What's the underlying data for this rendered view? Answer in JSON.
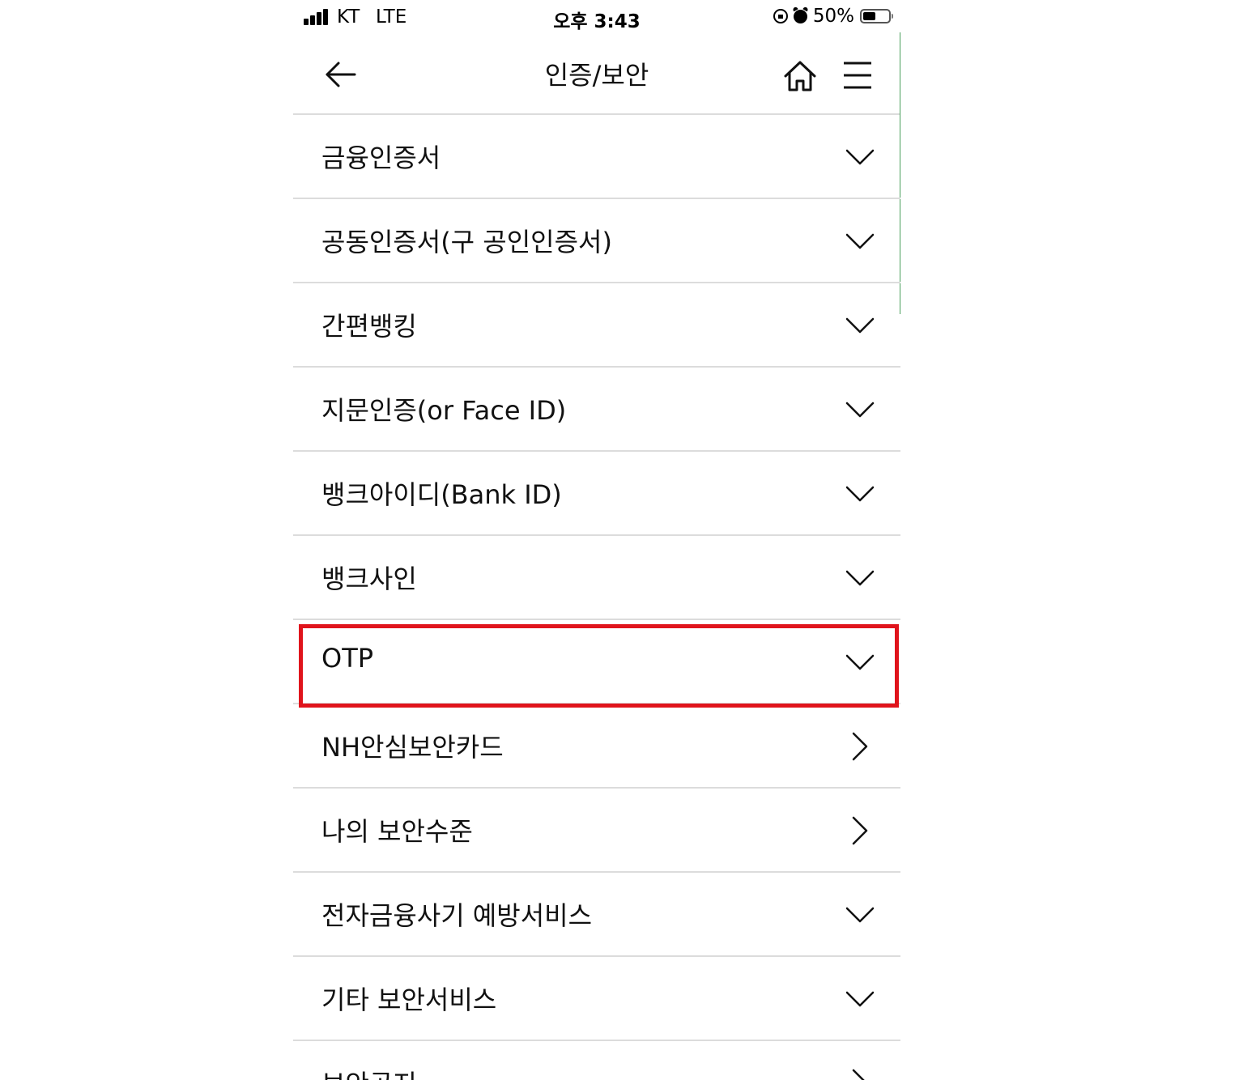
{
  "status_bar": {
    "carrier": "KT",
    "network": "LTE",
    "time": "오후 3:43",
    "battery": "50%",
    "battery_level": 0.5
  },
  "header": {
    "title": "인증/보안",
    "back_icon": "arrow-left-icon",
    "home_icon": "home-icon",
    "menu_icon": "hamburger-menu-icon"
  },
  "menu": {
    "items": [
      {
        "label": "금융인증서",
        "icon": "chevron-down-icon"
      },
      {
        "label": "공동인증서(구 공인인증서)",
        "icon": "chevron-down-icon"
      },
      {
        "label": "간편뱅킹",
        "icon": "chevron-down-icon"
      },
      {
        "label": "지문인증(or Face ID)",
        "icon": "chevron-down-icon"
      },
      {
        "label": "뱅크아이디(Bank ID)",
        "icon": "chevron-down-icon"
      },
      {
        "label": "뱅크사인",
        "icon": "chevron-down-icon"
      },
      {
        "label": "OTP",
        "icon": "chevron-down-icon",
        "highlighted": true
      },
      {
        "label": "NH안심보안카드",
        "icon": "chevron-right-icon"
      },
      {
        "label": "나의 보안수준",
        "icon": "chevron-right-icon"
      },
      {
        "label": "전자금융사기 예방서비스",
        "icon": "chevron-down-icon"
      },
      {
        "label": "기타 보안서비스",
        "icon": "chevron-down-icon"
      },
      {
        "label": "보안공지",
        "icon": "chevron-right-icon"
      }
    ]
  },
  "colors": {
    "highlight": "#e0141c",
    "divider": "#dcdcdc",
    "scroll_indicator": "#4a9e5c"
  }
}
